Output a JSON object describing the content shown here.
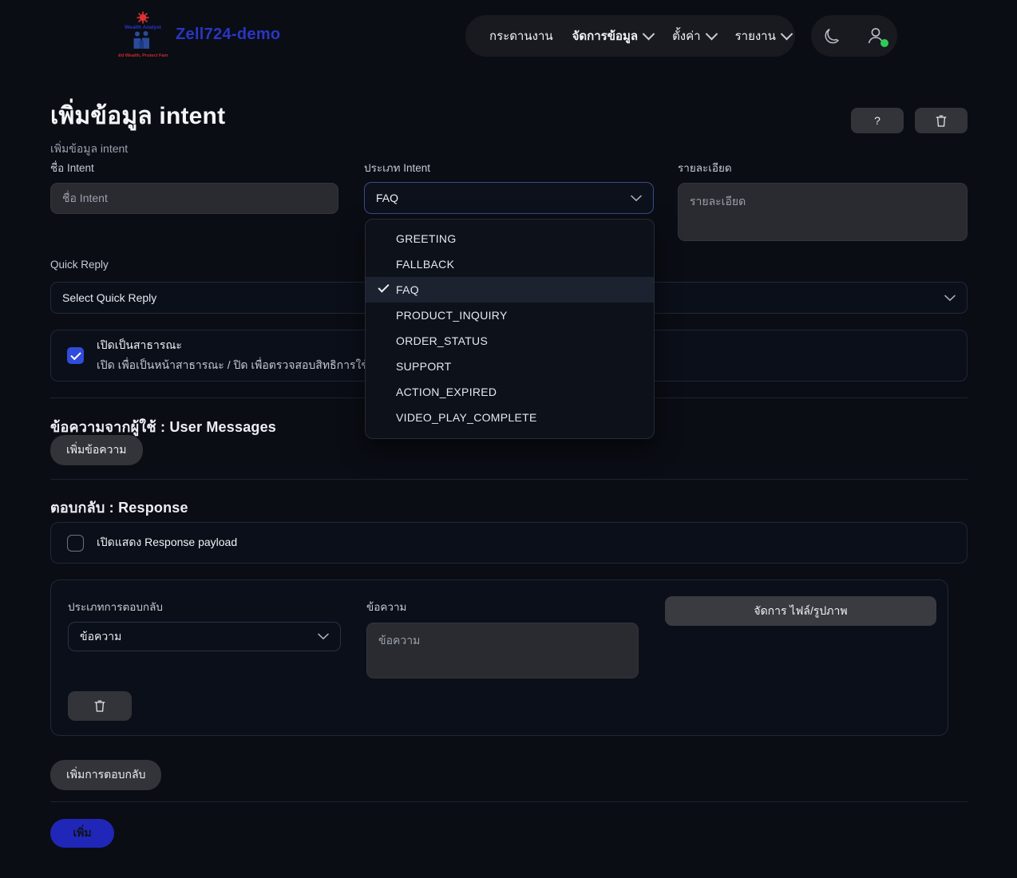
{
  "brand": {
    "name": "Zell724-demo",
    "logo_text_top": "Wealth Analyst",
    "logo_text_bottom": "Build Wealth, Protect Family"
  },
  "nav": {
    "items": [
      {
        "label": "กระดานงาน",
        "icon": "",
        "has_chevron": false,
        "strong": false
      },
      {
        "label": "จัดการข้อมูล",
        "icon": "chevron-down-icon",
        "has_chevron": true,
        "strong": true
      },
      {
        "label": "ตั้งค่า",
        "icon": "chevron-down-icon",
        "has_chevron": true,
        "strong": false
      },
      {
        "label": "รายงาน",
        "icon": "chevron-down-icon",
        "has_chevron": true,
        "strong": false
      }
    ],
    "theme_toggle_icon": "moon-icon",
    "profile_icon": "user-icon",
    "status_color": "#2ecc56"
  },
  "header": {
    "title": "เพิ่มข้อมูล intent",
    "subtitle": "เพิ่มข้อมูล intent",
    "help_label": "?",
    "delete_icon": "trash-icon"
  },
  "form": {
    "intent_name": {
      "label": "ชื่อ Intent",
      "placeholder": "ชื่อ Intent",
      "value": ""
    },
    "intent_type": {
      "label": "ประเภท Intent",
      "value": "FAQ",
      "chevron": "chevron-down-icon"
    },
    "detail": {
      "label": "รายละเอียด",
      "placeholder": "รายละเอียด",
      "value": ""
    },
    "quick_reply": {
      "label": "Quick Reply",
      "value": "Select Quick Reply",
      "chevron": "chevron-down-icon"
    }
  },
  "dropdown": {
    "open": true,
    "selected": "FAQ",
    "options": [
      "GREETING",
      "FALLBACK",
      "FAQ",
      "PRODUCT_INQUIRY",
      "ORDER_STATUS",
      "SUPPORT",
      "ACTION_EXPIRED",
      "VIDEO_PLAY_COMPLETE"
    ]
  },
  "public_toggle": {
    "checked": true,
    "title": "เปิดเป็นสาธารณะ",
    "description": "เปิด เพื่อเป็นหน้าสาธารณะ / ปิด เพื่อตรวจสอบสิทธิการใช้งาน"
  },
  "user_messages": {
    "heading": "ข้อความจากผู้ใช้ : User Messages",
    "add_button": "เพิ่มข้อความ"
  },
  "response": {
    "heading": "ตอบกลับ : Response",
    "payload_toggle": {
      "checked": false,
      "label": "เปิดแสดง Response payload"
    },
    "item": {
      "type_label": "ประเภทการตอบกลับ",
      "type_value": "ข้อความ",
      "type_chevron": "chevron-down-icon",
      "message_label": "ข้อความ",
      "message_placeholder": "ข้อความ",
      "message_value": "",
      "file_button": "จัดการ ไฟล์/รูปภาพ",
      "delete_icon": "trash-icon"
    },
    "add_response_button": "เพิ่มการตอบกลับ"
  },
  "footer": {
    "submit_label": "เพิ่ม",
    "submit_color": "#2027b8"
  },
  "colors": {
    "page_bg": "#0a0d14",
    "card_bg": "#0b0f19",
    "input_bg": "#2a2b30",
    "accent_blue": "#2f4cdb",
    "focus_border": "#3b4a8c",
    "brand_blue": "#2a36c4"
  }
}
